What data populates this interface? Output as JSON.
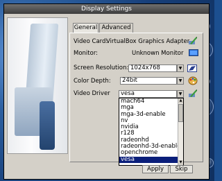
{
  "window": {
    "title": "Display Settings"
  },
  "tabs": [
    {
      "label": "General",
      "active": true
    },
    {
      "label": "Advanced",
      "active": false
    }
  ],
  "fields": {
    "video_card_label": "Video Card:",
    "video_card_value": "VirtualBox Graphics Adapter",
    "monitor_label": "Monitor:",
    "monitor_value": "Unknown Monitor",
    "resolution_label": "Screen Resolution:",
    "resolution_value": "1024x768",
    "color_depth_label": "Color Depth:",
    "color_depth_value": "24bit",
    "video_driver_label": "Video Driver",
    "video_driver_value": "vesa"
  },
  "driver_options": [
    "mach64",
    "mga",
    "mga-3d-enable",
    "nv",
    "nvidia",
    "r128",
    "radeonhd",
    "radeonhd-3d-enable",
    "openchrome",
    "vesa"
  ],
  "selected_driver": "vesa",
  "buttons": {
    "apply": "Apply",
    "skip": "Skip"
  },
  "colors": {
    "selection": "#0a1e7a",
    "titlebar": "#3d3d3d",
    "desktop": "#1c4f8f"
  }
}
